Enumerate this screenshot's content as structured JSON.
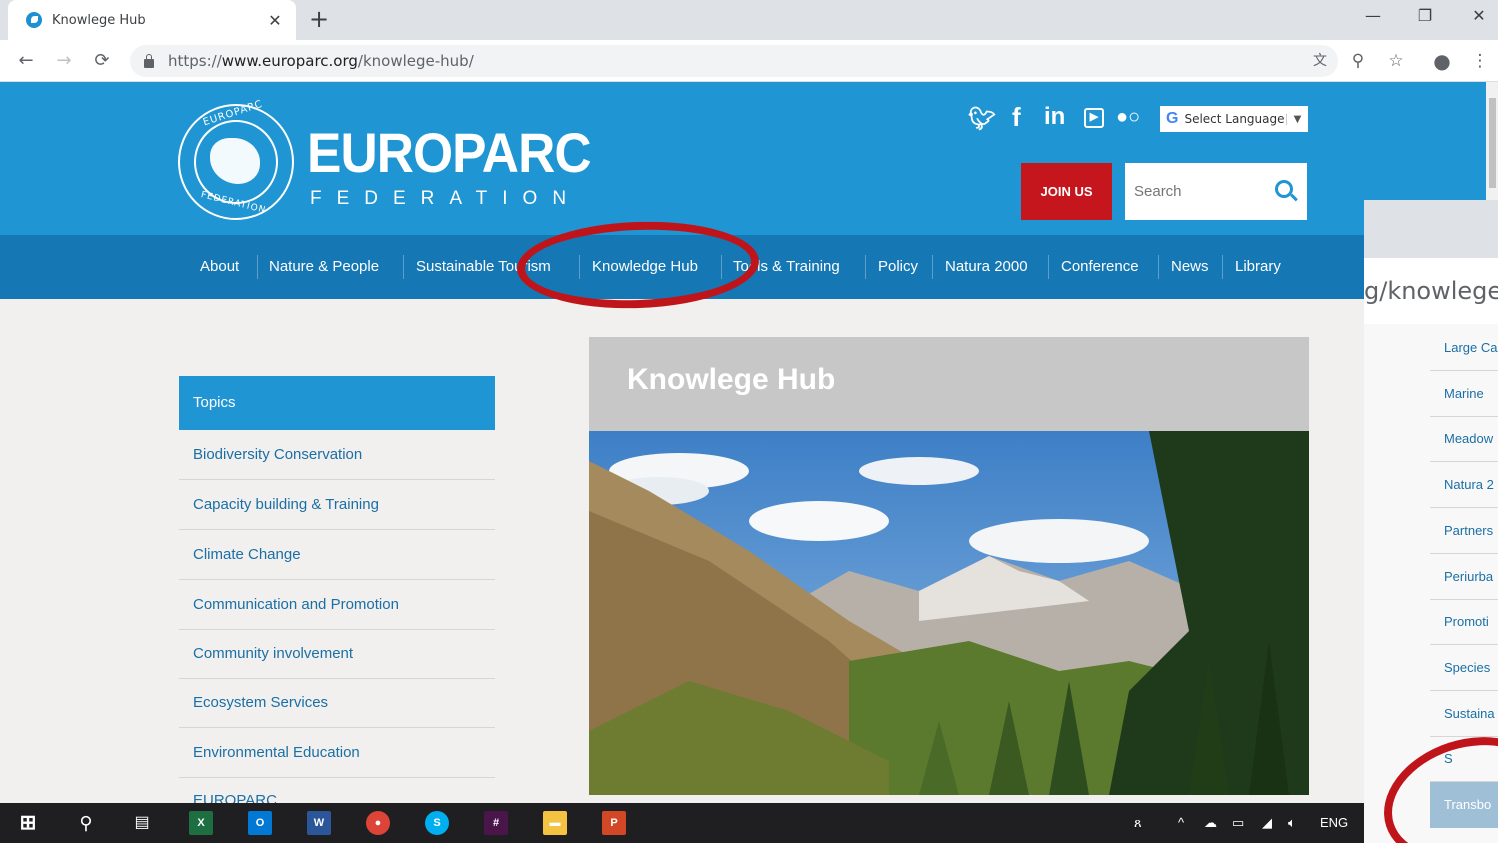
{
  "browser": {
    "tab_title": "Knowlege Hub",
    "tab_close": "✕",
    "new_tab": "+",
    "url_prefix": "https://",
    "url_host": "www.europarc.org",
    "url_path": "/knowlege-hub/",
    "window_controls": [
      "—",
      "❐",
      "✕"
    ]
  },
  "header": {
    "logo_name": "EUROPARC",
    "logo_sub": "FEDERATION",
    "logo_ring_top": "EUROPARC",
    "logo_ring_bottom": "FEDERATION",
    "language_label": "Select Language",
    "join_label": "JOIN US",
    "search_placeholder": "Search"
  },
  "nav": {
    "items": [
      "About",
      "Nature & People",
      "Sustainable Tourism",
      "Knowledge Hub",
      "Tools & Training",
      "Policy",
      "Natura 2000",
      "Conference",
      "News",
      "Library"
    ]
  },
  "sidebar": {
    "header": "Topics",
    "items": [
      "Biodiversity Conservation",
      "Capacity building & Training",
      "Climate Change",
      "Communication and Promotion",
      "Community involvement",
      "Ecosystem Services",
      "Environmental Education",
      "EUROPARC"
    ]
  },
  "content": {
    "title": "Knowlege Hub"
  },
  "overlap_window": {
    "url_fragment": "g/knowlege-",
    "items": [
      "Large Ca",
      "Marine",
      "Meadow",
      "Natura 2",
      "Partners",
      "Periurba",
      "Promoti",
      "Species",
      "Sustaina",
      "S"
    ],
    "button": "Transbo"
  },
  "taskbar": {
    "lang": "ENG"
  },
  "colors": {
    "brand_blue": "#1f95d3",
    "nav_blue": "#1577b3",
    "join_red": "#c4161c",
    "annotation_red": "#c0141b"
  }
}
